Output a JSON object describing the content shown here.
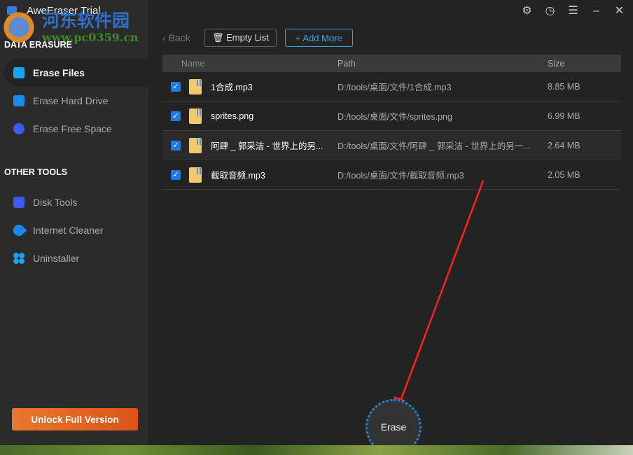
{
  "window": {
    "title": "AweEraser Trial"
  },
  "watermark": {
    "cn": "河东软件园",
    "url": "www.pc0359.cn"
  },
  "sidebar": {
    "section1": "DATA ERASURE",
    "section2": "OTHER TOOLS",
    "items": [
      {
        "label": "Erase Files",
        "icon": "folder-icon",
        "color": "#1aa3f0"
      },
      {
        "label": "Erase Hard Drive",
        "icon": "hard-drive-icon",
        "color": "#1a8ae8"
      },
      {
        "label": "Erase Free Space",
        "icon": "pie-chart-icon",
        "color": "#3b5cf0"
      }
    ],
    "tools": [
      {
        "label": "Disk Tools",
        "icon": "toolbox-icon",
        "color": "#3b5cf0"
      },
      {
        "label": "Internet Cleaner",
        "icon": "rocket-icon",
        "color": "#1a8ae8"
      },
      {
        "label": "Uninstaller",
        "icon": "apps-icon",
        "color": "#1aa3f0"
      }
    ],
    "unlock": "Unlock Full Version"
  },
  "toolbar": {
    "back": "Back",
    "empty": "Empty List",
    "add": "Add More"
  },
  "table": {
    "headers": [
      "Name",
      "Path",
      "Size"
    ],
    "rows": [
      {
        "name": "1合成.mp3",
        "path": "D:/tools/桌面/文件/1合成.mp3",
        "size": "8.85 MB"
      },
      {
        "name": "sprites.png",
        "path": "D:/tools/桌面/文件/sprites.png",
        "size": "6.99 MB"
      },
      {
        "name": "阿肆 _ 郭采洁 - 世界上的另...",
        "path": "D:/tools/桌面/文件/阿肆 _ 郭采洁 - 世界上的另一...",
        "size": "2.64 MB"
      },
      {
        "name": "截取音频.mp3",
        "path": "D:/tools/桌面/文件/截取音频.mp3",
        "size": "2.05 MB"
      }
    ]
  },
  "erase": "Erase"
}
